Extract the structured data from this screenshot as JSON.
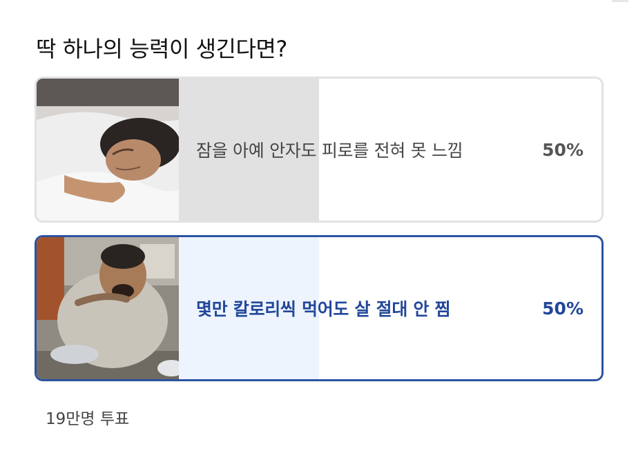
{
  "poll": {
    "question": "딱 하나의 능력이 생긴다면?",
    "options": [
      {
        "label": "잠을 아예 안자도 피로를 전혀 못 느낌",
        "percent_label": "50%",
        "percent": 50,
        "selected": false,
        "image": "sleeping-man-photo"
      },
      {
        "label": "몇만 칼로리씩 먹어도 살 절대 안 찜",
        "percent_label": "50%",
        "percent": 50,
        "selected": true,
        "image": "eating-man-photo"
      }
    ],
    "vote_count": "19만명 투표"
  },
  "colors": {
    "selected_accent": "#2b53a3",
    "selected_fill": "#edf4fd",
    "unselected_fill": "#e1e1e1",
    "unselected_border": "#e2e2e2"
  }
}
